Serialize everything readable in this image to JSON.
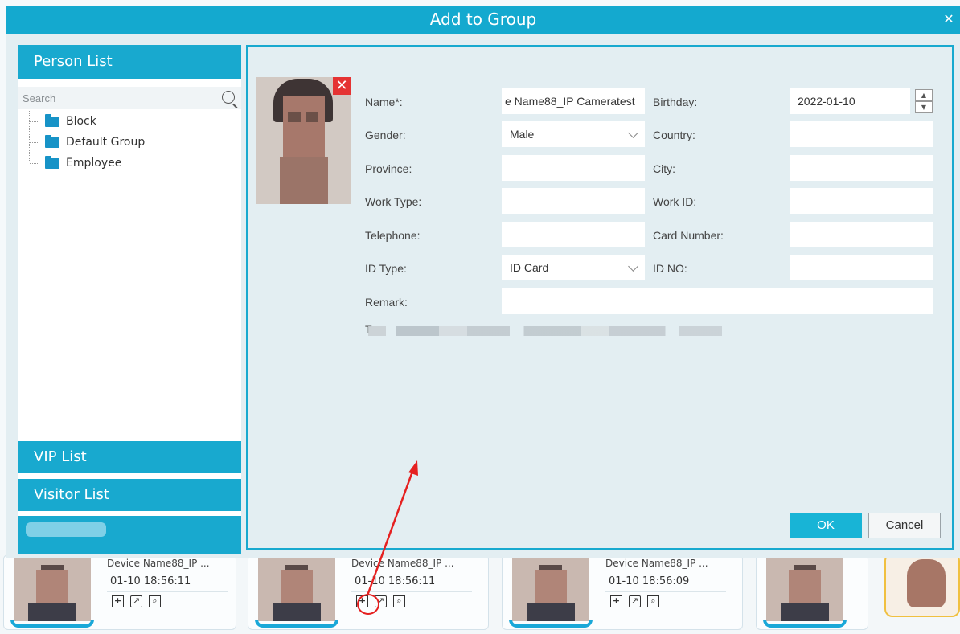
{
  "dialog": {
    "title": "Add to Group",
    "close": "✕"
  },
  "left_panel": {
    "person_list": "Person List",
    "search_placeholder": "Search",
    "groups": [
      {
        "label": "Block"
      },
      {
        "label": "Default Group"
      },
      {
        "label": "Employee"
      }
    ],
    "vip_list": "VIP List",
    "visitor_list": "Visitor List"
  },
  "form": {
    "name_label": "Name*:",
    "name_value": "e Name88_IP Cameratest",
    "birthday_label": "Birthday:",
    "birthday_value": "2022-01-10",
    "gender_label": "Gender:",
    "gender_value": "Male",
    "country_label": "Country:",
    "country_value": "",
    "province_label": "Province:",
    "province_value": "",
    "city_label": "City:",
    "city_value": "",
    "work_type_label": "Work Type:",
    "work_type_value": "",
    "work_id_label": "Work ID:",
    "work_id_value": "",
    "telephone_label": "Telephone:",
    "telephone_value": "",
    "card_number_label": "Card Number:",
    "card_number_value": "",
    "id_type_label": "ID Type:",
    "id_type_value": "ID Card",
    "id_no_label": "ID NO:",
    "id_no_value": "",
    "remark_label": "Remark:",
    "remark_value": "",
    "tip_prefix": "T",
    "ok": "OK",
    "cancel": "Cancel"
  },
  "captures": [
    {
      "device": "Device Name88_IP ...",
      "time": "01-10 18:56:11"
    },
    {
      "device": "Device Name88_IP ...",
      "time": "01-10 18:56:11"
    },
    {
      "device": "Device Name88_IP ...",
      "time": "01-10 18:56:09"
    }
  ],
  "colors": {
    "accent": "#18a9cf",
    "remove": "#e53333",
    "annotation": "#e52020"
  },
  "icons": [
    "close-icon",
    "search-icon",
    "folder-icon",
    "remove-photo-icon",
    "chevron-down-icon",
    "spin-up-icon",
    "spin-down-icon",
    "add-to-group-icon",
    "export-icon",
    "search-image-icon"
  ]
}
